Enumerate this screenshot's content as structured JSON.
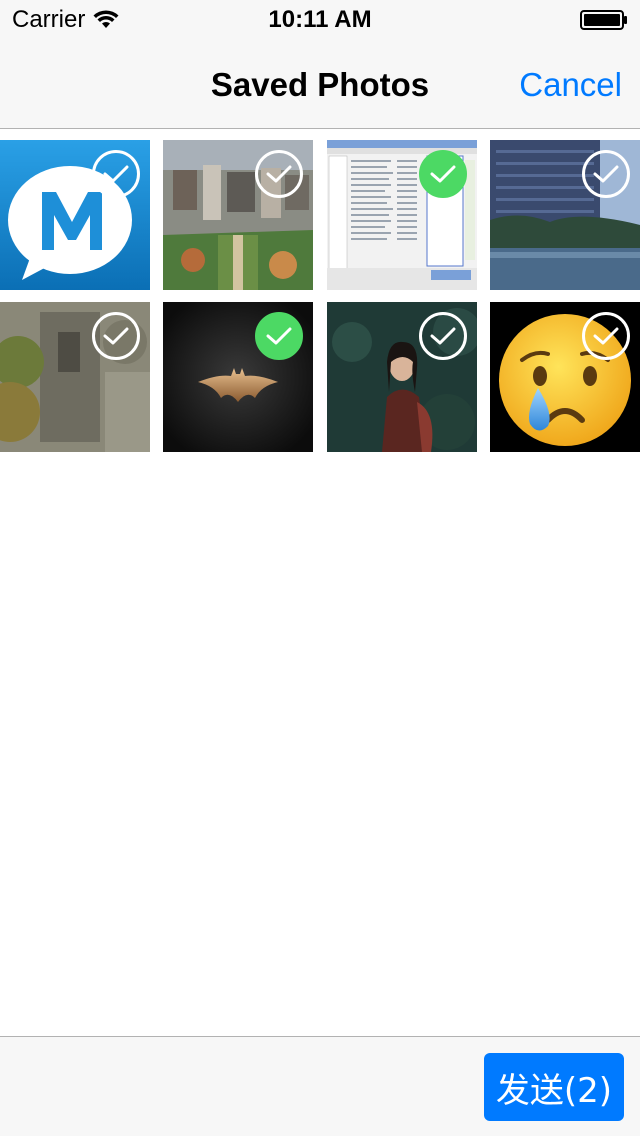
{
  "status_bar": {
    "carrier": "Carrier",
    "time": "10:11 AM",
    "icons": [
      "wifi-icon",
      "battery-icon"
    ]
  },
  "nav": {
    "title": "Saved Photos",
    "cancel_label": "Cancel"
  },
  "photos": [
    {
      "subject": "chat app logo",
      "selected": false
    },
    {
      "subject": "aerial city view",
      "selected": false
    },
    {
      "subject": "file manager screenshot",
      "selected": true
    },
    {
      "subject": "building by water",
      "selected": false
    },
    {
      "subject": "stone wall with foliage",
      "selected": false
    },
    {
      "subject": "bat emblem",
      "selected": true
    },
    {
      "subject": "woman portrait",
      "selected": false
    },
    {
      "subject": "crying face emoji",
      "selected": false
    }
  ],
  "toolbar": {
    "send_label": "发送(2)"
  },
  "colors": {
    "accent": "#007aff",
    "selected_check": "#4cd964",
    "bar_background": "#f7f7f7"
  }
}
